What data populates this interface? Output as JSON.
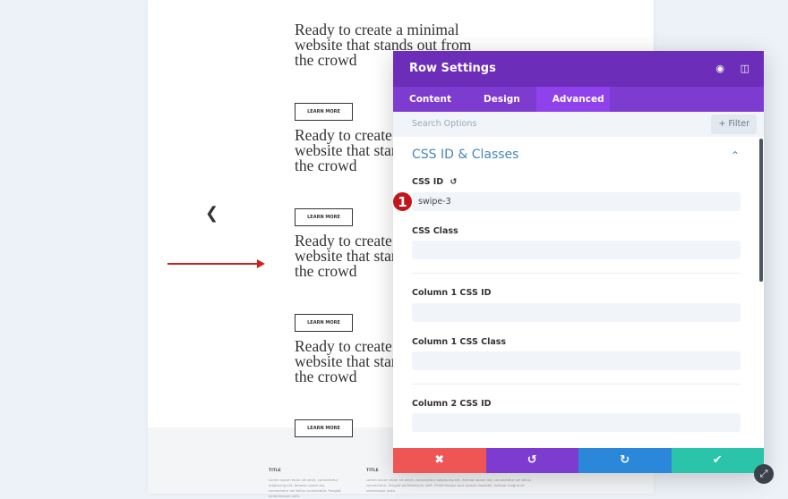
{
  "page": {
    "hero_text": "Ready to create a minimal website that stands out from the crowd",
    "button_label": "LEARN MORE",
    "footer": {
      "columns": [
        {
          "title": "TITLE",
          "text": "Lorem ipsum dolor sit amet, consectetur adipiscing elit. Aenean quam leo, consectetur vel tellus consectetur. Feugiat pellentesque velit."
        },
        {
          "title": "TITLE",
          "text": "Lorem ipsum dolor sit amet, consectetur adipiscing elit. Aenean quam leo, consectetur vel tellus consectetur. Feugiat pellentesque velit. Pellentesque quis massa molestie, tempor magna et, scelerisque justo."
        }
      ]
    }
  },
  "modal": {
    "title": "Row Settings",
    "tabs": [
      {
        "label": "Content"
      },
      {
        "label": "Design"
      },
      {
        "label": "Advanced",
        "active": true
      }
    ],
    "search_placeholder": "Search Options",
    "filter_label": "+ Filter",
    "section_title": "CSS ID & Classes",
    "fields": [
      {
        "label": "CSS ID",
        "value": "swipe-3"
      },
      {
        "label": "CSS Class",
        "value": ""
      },
      {
        "label": "Column 1 CSS ID",
        "value": ""
      },
      {
        "label": "Column 1 CSS Class",
        "value": ""
      },
      {
        "label": "Column 2 CSS ID",
        "value": ""
      }
    ],
    "annotation_badge": "1",
    "colors": {
      "header": "#6c2eb9",
      "tabs": "#7e3bd0",
      "cancel": "#ef5555",
      "undo": "#7e3bd0",
      "redo": "#2b87da",
      "save": "#29c4a9"
    }
  }
}
